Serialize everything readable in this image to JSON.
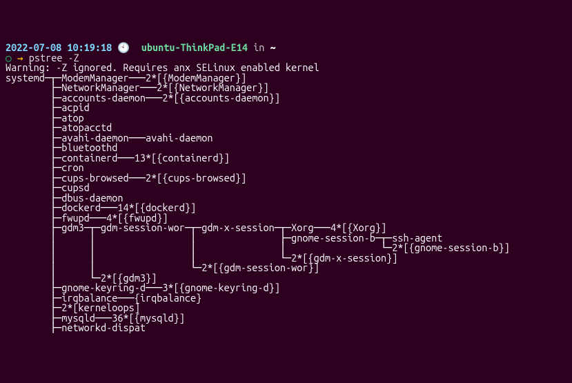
{
  "prompt": {
    "timestamp": "2022-07-08 10:19:18",
    "clock_glyph": "🕙",
    "hostname": "ubuntu-ThinkPad-E14",
    "in_word": "in",
    "cwd": "~",
    "circle": "○",
    "arrow": "→",
    "command": "pstree -Z"
  },
  "warning": "Warning: -Z ignored. Requires anx SELinux enabled kernel",
  "tree_lines": [
    "systemd─┬─ModemManager───2*[{ModemManager}]",
    "        ├─NetworkManager───2*[{NetworkManager}]",
    "        ├─accounts-daemon───2*[{accounts-daemon}]",
    "        ├─acpid",
    "        ├─atop",
    "        ├─atopacctd",
    "        ├─avahi-daemon───avahi-daemon",
    "        ├─bluetoothd",
    "        ├─containerd───13*[{containerd}]",
    "        ├─cron",
    "        ├─cups-browsed───2*[{cups-browsed}]",
    "        ├─cupsd",
    "        ├─dbus-daemon",
    "        ├─dockerd───14*[{dockerd}]",
    "        ├─fwupd───4*[{fwupd}]",
    "        ├─gdm3─┬─gdm-session-wor─┬─gdm-x-session─┬─Xorg───4*[{Xorg}]",
    "        │      │                 │               ├─gnome-session-b─┬─ssh-agent",
    "        │      │                 │               │                 └─2*[{gnome-session-b}]",
    "        │      │                 │               └─2*[{gdm-x-session}]",
    "        │      │                 └─2*[{gdm-session-wor}]",
    "        │      └─2*[{gdm3}]",
    "        ├─gnome-keyring-d───3*[{gnome-keyring-d}]",
    "        ├─irqbalance───{irqbalance}",
    "        ├─2*[kerneloops]",
    "        ├─mysqld───36*[{mysqld}]",
    "        ├─networkd-dispat"
  ]
}
